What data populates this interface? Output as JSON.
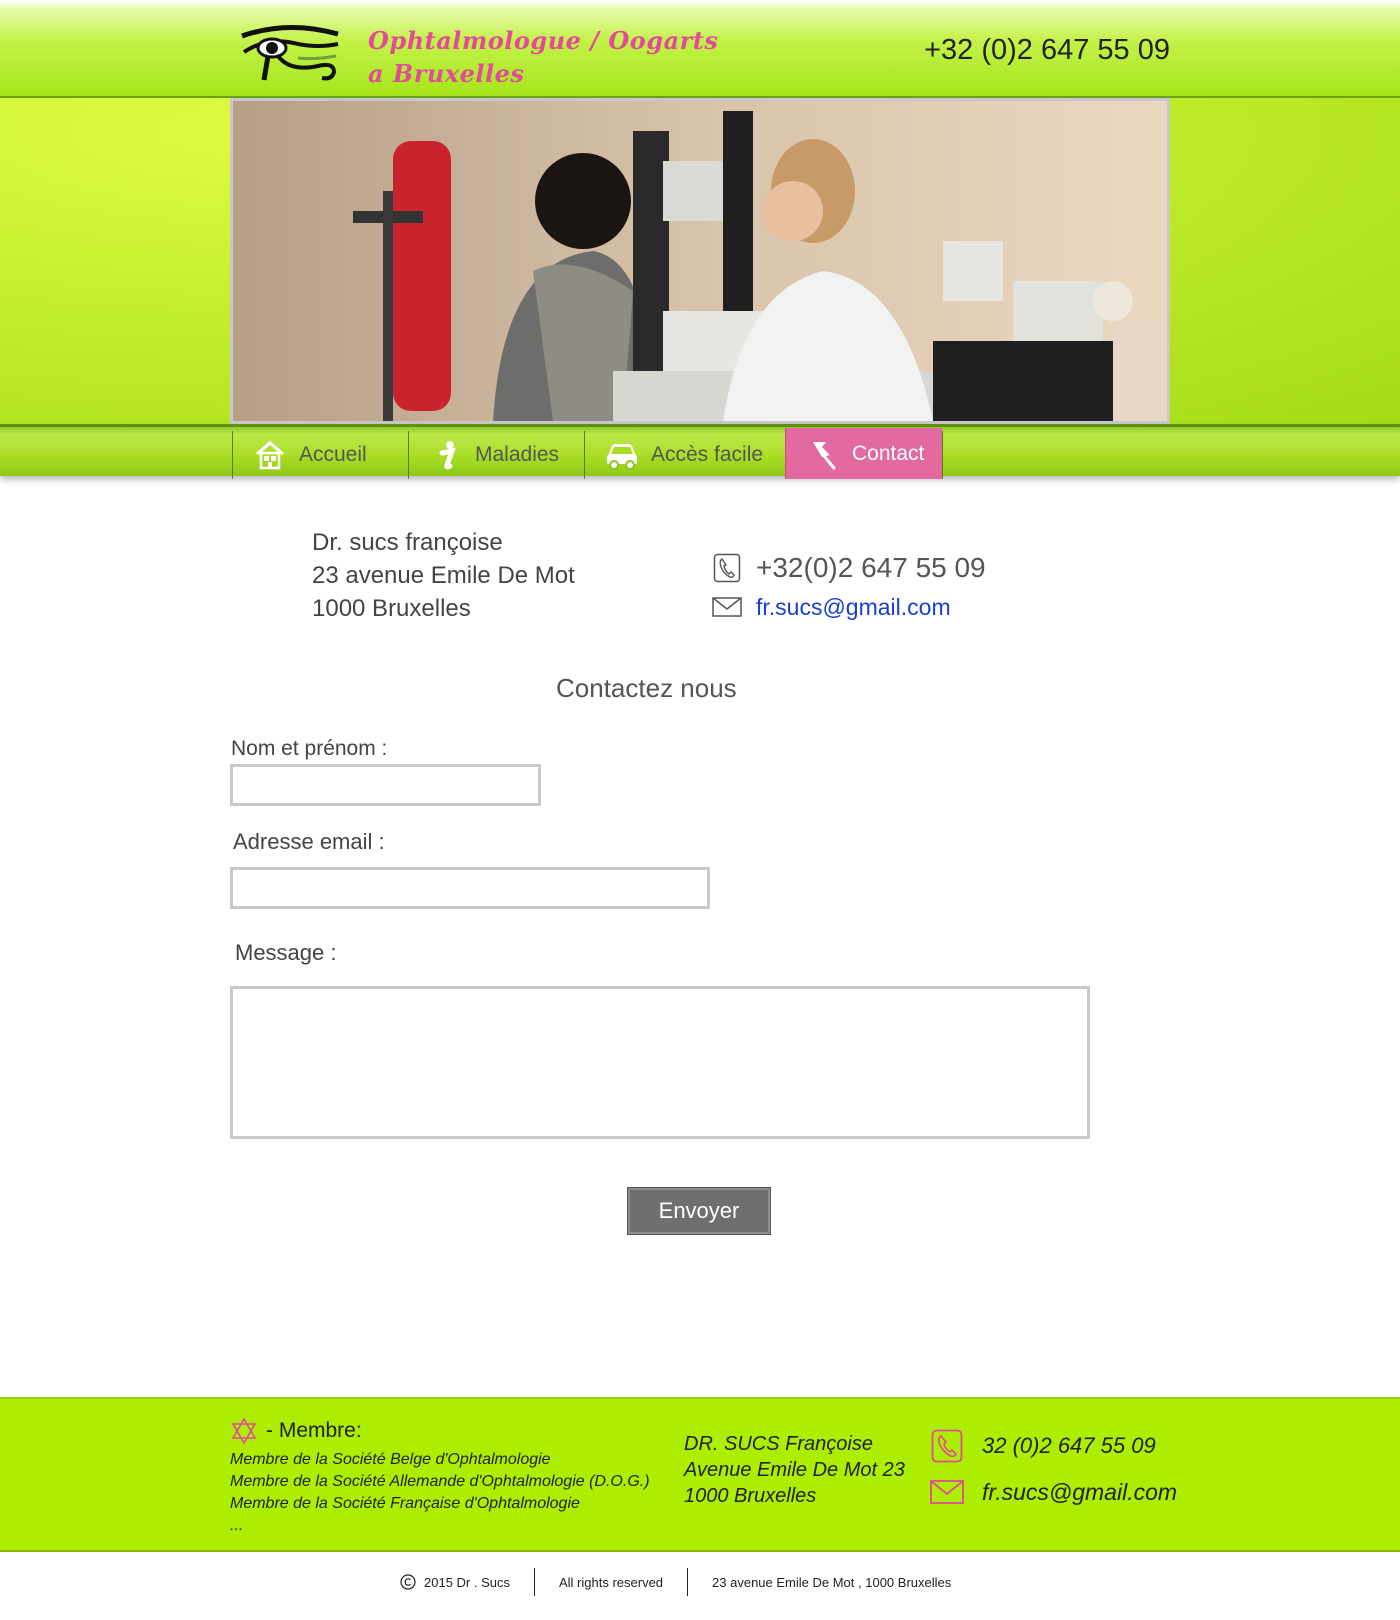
{
  "header": {
    "title_line1": "Ophtalmologue / Oogarts",
    "title_line2": "a Bruxelles",
    "phone": "+32 (0)2 647 55 09"
  },
  "nav": {
    "items": [
      {
        "label": "Accueil",
        "icon": "home-icon"
      },
      {
        "label": "Maladies",
        "icon": "info-icon"
      },
      {
        "label": "Accès facile",
        "icon": "car-icon"
      },
      {
        "label": "Contact",
        "icon": "pin-icon",
        "active": true
      }
    ]
  },
  "contact": {
    "name": "Dr. sucs françoise",
    "street": "23 avenue Emile De Mot",
    "city": "1000 Bruxelles",
    "phone": "+32(0)2 647 55 09",
    "email": "fr.sucs@gmail.com"
  },
  "form": {
    "title": "Contactez nous",
    "name_label": "Nom et prénom :",
    "email_label": "Adresse email :",
    "message_label": "Message :",
    "submit_label": "Envoyer"
  },
  "footer": {
    "member_heading": "- Membre:",
    "members": [
      "Membre de la Société Belge d'Ophtalmologie",
      "Membre de la Société Allemande d'Ophtalmologie (D.O.G.)",
      "Membre de la Société Française d'Ophtalmologie",
      "..."
    ],
    "addr_name": "DR. SUCS Françoise",
    "addr_street": "Avenue Emile De Mot 23",
    "addr_city": "1000 Bruxelles",
    "phone": "32 (0)2 647 55 09",
    "email": "fr.sucs@gmail.com"
  },
  "bottom": {
    "copyright": "2015 Dr . Sucs",
    "rights": "All rights reserved",
    "address": "23 avenue Emile De Mot , 1000 Bruxelles"
  },
  "colors": {
    "accent_pink": "#e24a9a",
    "nav_active": "#e36aa0",
    "lime": "#adee00",
    "link_blue": "#1a3fd0"
  }
}
